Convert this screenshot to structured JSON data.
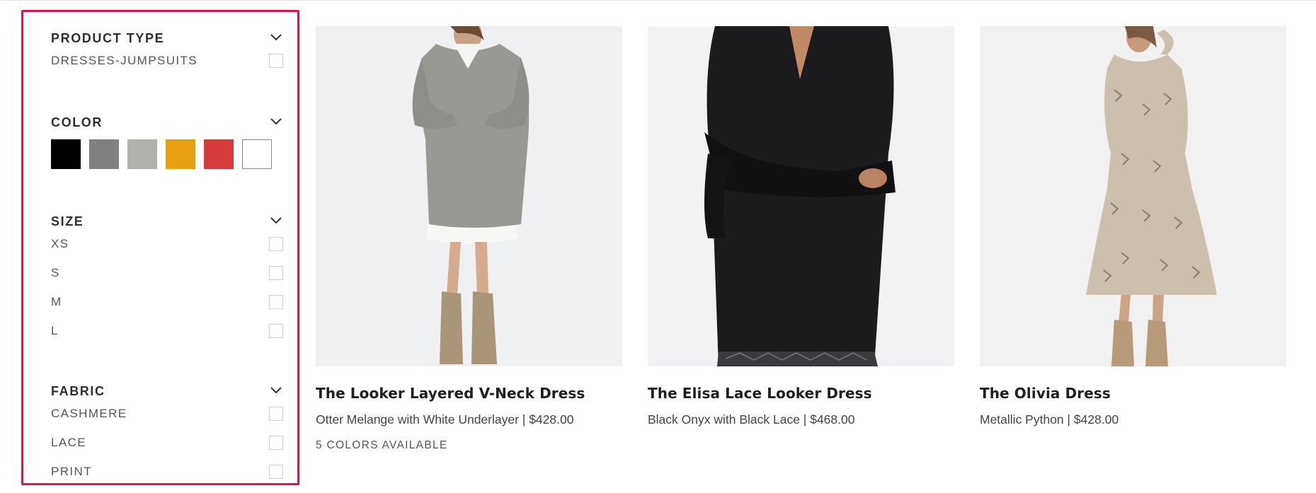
{
  "filters": {
    "product_type": {
      "title": "PRODUCT TYPE",
      "options": [
        {
          "label": "DRESSES-JUMPSUITS"
        }
      ]
    },
    "color": {
      "title": "COLOR",
      "swatches": [
        {
          "name": "black",
          "hex": "#000000"
        },
        {
          "name": "grey",
          "hex": "#808080"
        },
        {
          "name": "light-grey",
          "hex": "#b0b0ad"
        },
        {
          "name": "yellow",
          "hex": "#e8a012"
        },
        {
          "name": "red",
          "hex": "#d63b3b"
        },
        {
          "name": "white",
          "hex": "#ffffff"
        }
      ]
    },
    "size": {
      "title": "SIZE",
      "options": [
        {
          "label": "XS"
        },
        {
          "label": "S"
        },
        {
          "label": "M"
        },
        {
          "label": "L"
        }
      ]
    },
    "fabric": {
      "title": "FABRIC",
      "options": [
        {
          "label": "CASHMERE"
        },
        {
          "label": "LACE"
        },
        {
          "label": "PRINT"
        }
      ]
    }
  },
  "products": [
    {
      "name": "The Looker Layered V-Neck Dress",
      "description": "Otter Melange with White Underlayer | $428.00",
      "colors_available": "5 COLORS AVAILABLE"
    },
    {
      "name": "The Elisa Lace Looker Dress",
      "description": "Black Onyx with Black Lace | $468.00"
    },
    {
      "name": "The Olivia Dress",
      "description": "Metallic Python | $428.00"
    }
  ],
  "accent_color": "#e0134e"
}
